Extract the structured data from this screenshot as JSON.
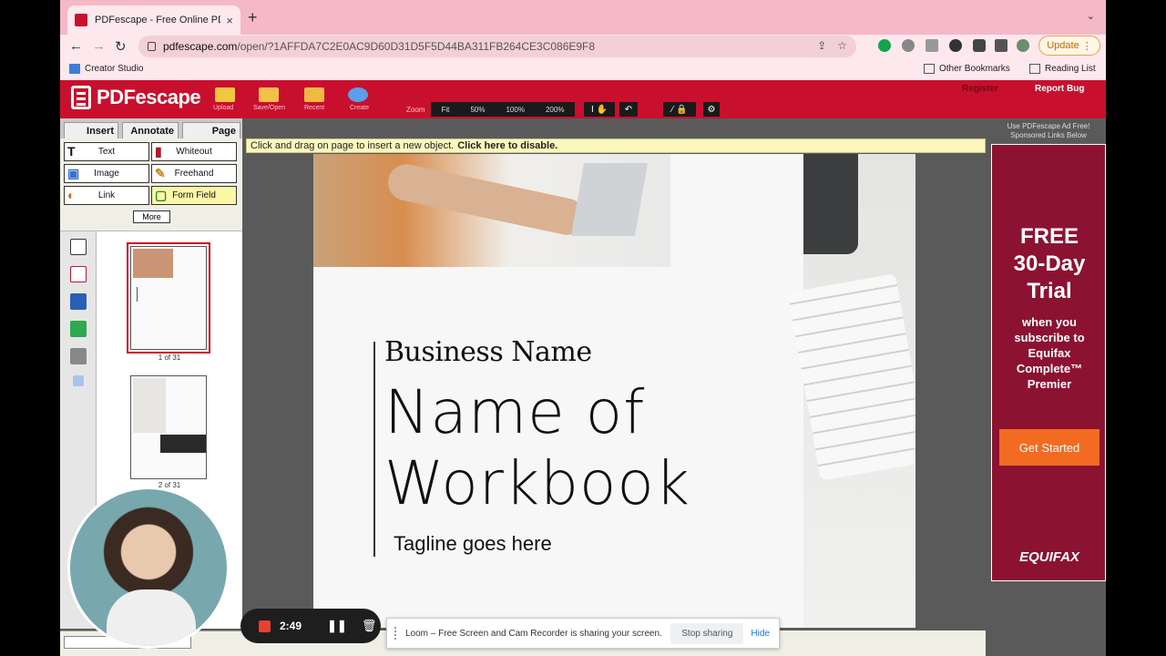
{
  "browser": {
    "tab_title": "PDFescape - Free Online PDF E",
    "tab_close": "×",
    "new_tab": "+",
    "tab_menu": "⌄",
    "url_host": "pdfescape.com",
    "url_path": "/open/?1AFFDA7C2E0AC9D60D31D5F5D44BA311FB264CE3C086E9F8",
    "update_label": "Update",
    "bookmark_left": "Creator Studio",
    "bookmark_other": "Other Bookmarks",
    "bookmark_reading": "Reading List"
  },
  "app": {
    "logo_text": "PDFescape",
    "toolbar_labels": [
      "Upload",
      "Save/Open",
      "Recent",
      "Create"
    ],
    "zoom_label": "Zoom",
    "zoom_options": [
      "Fit",
      "50%",
      "100%",
      "200%"
    ],
    "register": "Register",
    "report_bug": "Report Bug"
  },
  "left": {
    "tabs": [
      "Insert",
      "Annotate",
      "Page"
    ],
    "tools": [
      {
        "label": "Text",
        "icon": "T"
      },
      {
        "label": "Whiteout",
        "icon": "▮"
      },
      {
        "label": "Image",
        "icon": "▣"
      },
      {
        "label": "Freehand",
        "icon": "✎"
      },
      {
        "label": "Link",
        "icon": "◐"
      },
      {
        "label": "Form Field",
        "icon": "▢"
      }
    ],
    "more": "More",
    "thumbnails": [
      "1 of 31",
      "2 of 31"
    ]
  },
  "doc": {
    "notice": "Click and drag on page to insert a new object.",
    "notice_link": "Click here to disable.",
    "business_name": "Business Name",
    "title_line1": "Name of",
    "title_line2": "Workbook",
    "tagline": "Tagline goes here"
  },
  "ad": {
    "top_note_1": "Use PDFescape Ad Free!",
    "top_note_2": "Sponsored Links Below",
    "headline_1": "FREE",
    "headline_2": "30-Day",
    "headline_3": "Trial",
    "sub_1": "when you",
    "sub_2": "subscribe to",
    "sub_3": "Equifax",
    "sub_4": "Complete™",
    "sub_5": "Premier",
    "cta": "Get Started",
    "brand": "EQUIFAX"
  },
  "loom": {
    "time": "2:49",
    "share_message": "Loom – Free Screen and Cam Recorder is sharing your screen.",
    "stop": "Stop sharing",
    "hide": "Hide"
  },
  "colors": {
    "brand_red": "#c8102e",
    "ad_bg": "#8c1232",
    "cta_orange": "#f26b21"
  }
}
